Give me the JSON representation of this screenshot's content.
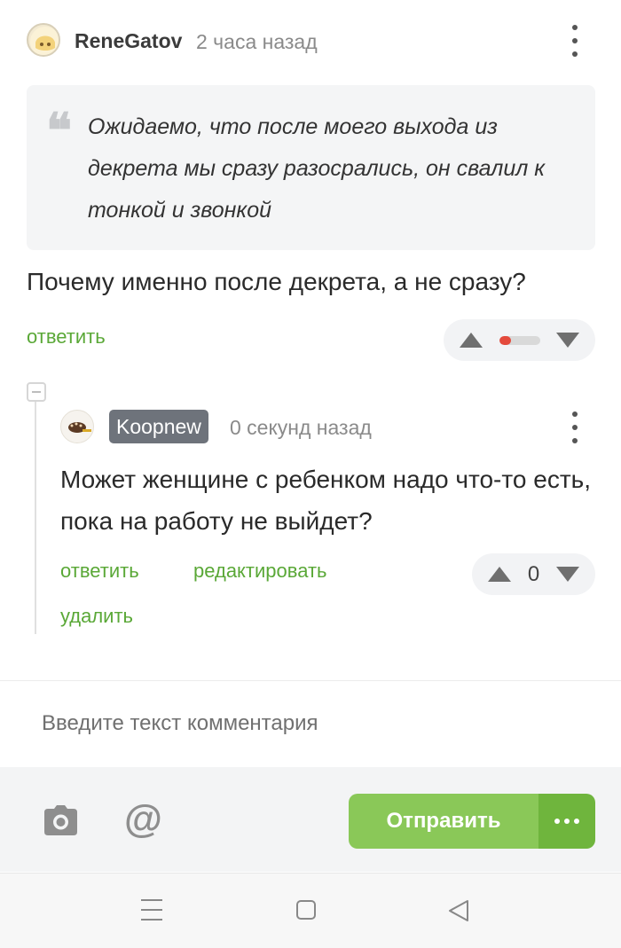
{
  "comment": {
    "author": "ReneGatov",
    "time": "2 часа назад",
    "quote": "Ожидаемо, что после моего выхода из декрета мы сразу разосрались, он свалил к тонкой и звонкой",
    "text": "Почему именно после декрета, а не сразу?",
    "reply_label": "ответить",
    "rating_negative_fraction": 0.3
  },
  "reply": {
    "author": "Koopnew",
    "time": "0 секунд назад",
    "text": "Может женщине с ребенком надо что-то есть, пока на работу не выйдет?",
    "reply_label": "ответить",
    "edit_label": "редактировать",
    "delete_label": "удалить",
    "score": "0"
  },
  "composer": {
    "placeholder": "Введите текст комментария",
    "mention_symbol": "@",
    "send_label": "Отправить"
  },
  "colors": {
    "link": "#5aa837",
    "send": "#8ac858",
    "send_more": "#6fb53d",
    "badge": "#6e737b",
    "negative": "#e44a3c"
  }
}
